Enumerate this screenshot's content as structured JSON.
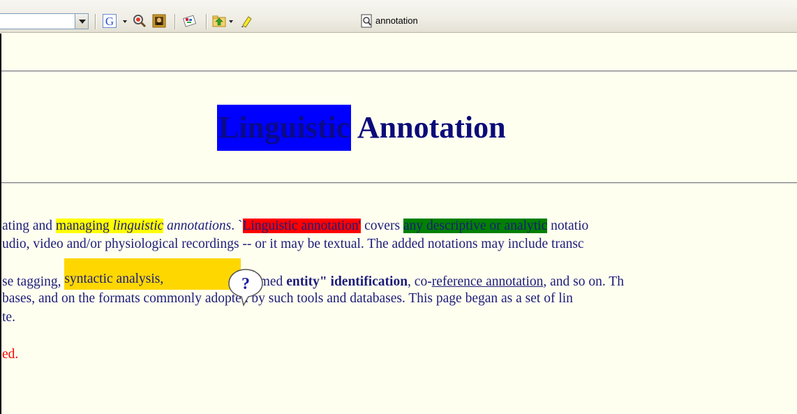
{
  "toolbar": {
    "address_value": "",
    "google_letter": "G",
    "find_text": "annotation",
    "icons": [
      "address-dropdown-arrow",
      "google-icon",
      "search-magnifier-icon",
      "mona-lisa-icon",
      "sticker-tool-icon",
      "folder-up-icon",
      "highlighter-icon",
      "page-find-icon"
    ]
  },
  "page": {
    "heading": {
      "highlighted_word": "Linguistic",
      "rest": "Annotation"
    },
    "para1": {
      "l1_a": "ating and ",
      "l1_b": "managing",
      "l1_c": " ",
      "l1_d": "linguistic",
      "l1_e": " ",
      "l1_f": "annotations",
      "l1_g": ". `",
      "l1_h": "Linguistic annotation'",
      "l1_i": " covers ",
      "l1_j": "any descriptive or analytic",
      "l1_k": " notatio",
      "l2": "udio, video and/or physiological recordings -- or it may be textual. The added notations may include transc"
    },
    "para2": {
      "l1_a": "se tagging, ",
      "l1_b": "syntactic analysis,",
      "l1_c": "\"named ",
      "l1_d": "entity\" identification",
      "l1_e": ", co-",
      "l1_f": "reference annotation",
      "l1_g": ", and so on. Th",
      "l2": "bases, and on the formats commonly adopted by such tools and databases. This page began as a set of lin",
      "l3": "te."
    },
    "para3": "ed.",
    "colors": {
      "blue_highlight": "#0000ff",
      "yellow_highlight": "#ffff00",
      "red_highlight": "#ff0000",
      "green_highlight": "#008000",
      "gold_highlight": "#ffd700",
      "text": "#1c1c7a",
      "background": "#fffff0"
    }
  }
}
